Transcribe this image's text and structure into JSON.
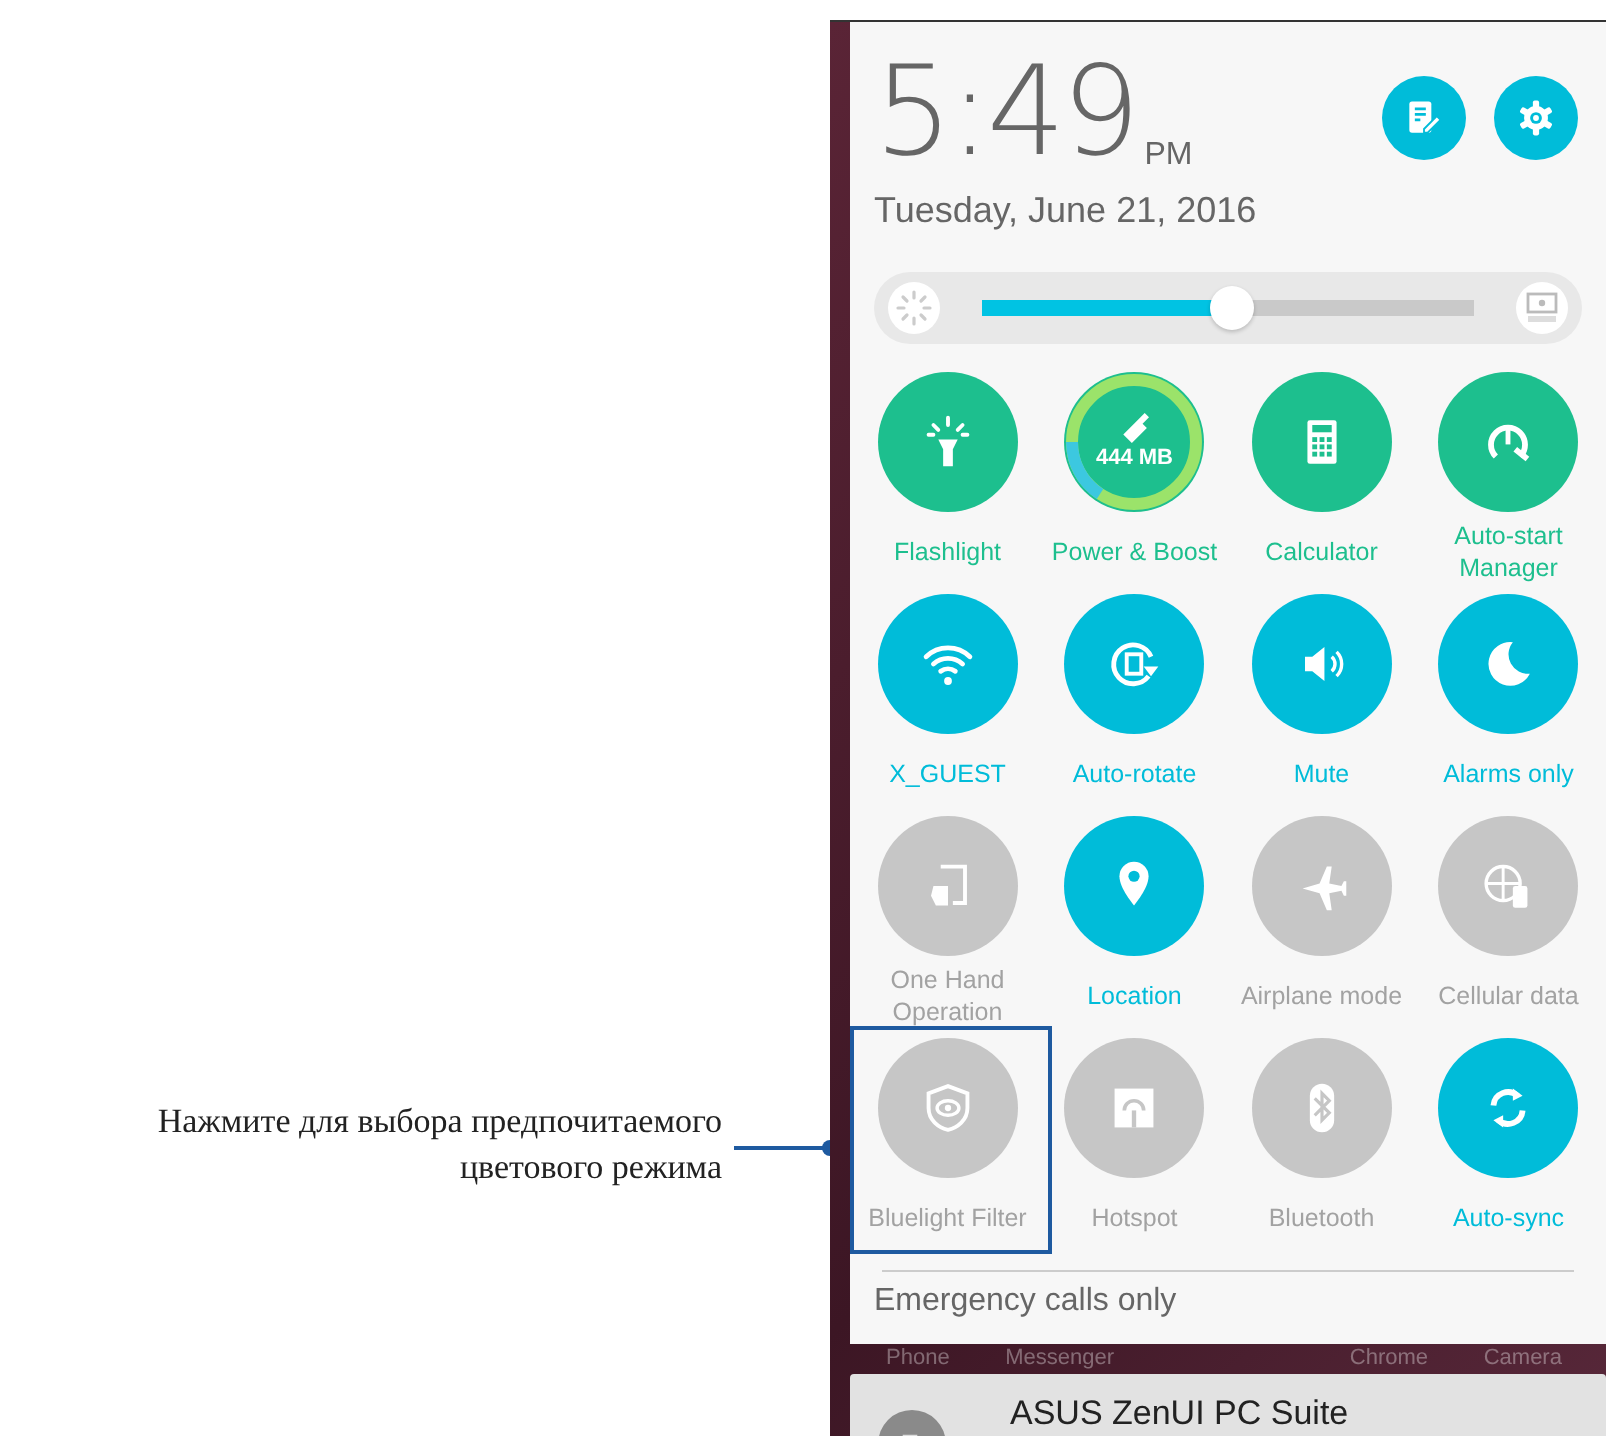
{
  "callout": {
    "text": "Нажмите для выбора предпочитаемого цветового режима"
  },
  "clock": {
    "time": "5:49",
    "ampm": "PM",
    "date": "Tuesday, June 21, 2016"
  },
  "brightness": {
    "level": 0.51
  },
  "tiles": [
    {
      "label": "Flashlight",
      "on": true,
      "color": "#1dbf8e"
    },
    {
      "label": "Power & Boost",
      "on": true,
      "color": "#1dbf8e",
      "badge": "444 MB"
    },
    {
      "label": "Calculator",
      "on": true,
      "color": "#1dbf8e"
    },
    {
      "label": "Auto-start Manager",
      "on": true,
      "color": "#1dbf8e"
    },
    {
      "label": "X_GUEST",
      "on": true,
      "color": "#00bcd9"
    },
    {
      "label": "Auto-rotate",
      "on": true,
      "color": "#00bcd9"
    },
    {
      "label": "Mute",
      "on": true,
      "color": "#00bcd9"
    },
    {
      "label": "Alarms only",
      "on": true,
      "color": "#00bcd9"
    },
    {
      "label": "One Hand Operation",
      "on": false
    },
    {
      "label": "Location",
      "on": true,
      "color": "#00bcd9"
    },
    {
      "label": "Airplane mode",
      "on": false
    },
    {
      "label": "Cellular data",
      "on": false
    },
    {
      "label": "Bluelight Filter",
      "on": false,
      "highlighted": true
    },
    {
      "label": "Hotspot",
      "on": false
    },
    {
      "label": "Bluetooth",
      "on": false
    },
    {
      "label": "Auto-sync",
      "on": true,
      "color": "#00bcd9"
    }
  ],
  "status": "Emergency calls only",
  "dock": [
    "Phone",
    "Messenger",
    "Chrome",
    "Camera"
  ],
  "notification": {
    "title": "ASUS ZenUI PC Suite"
  }
}
